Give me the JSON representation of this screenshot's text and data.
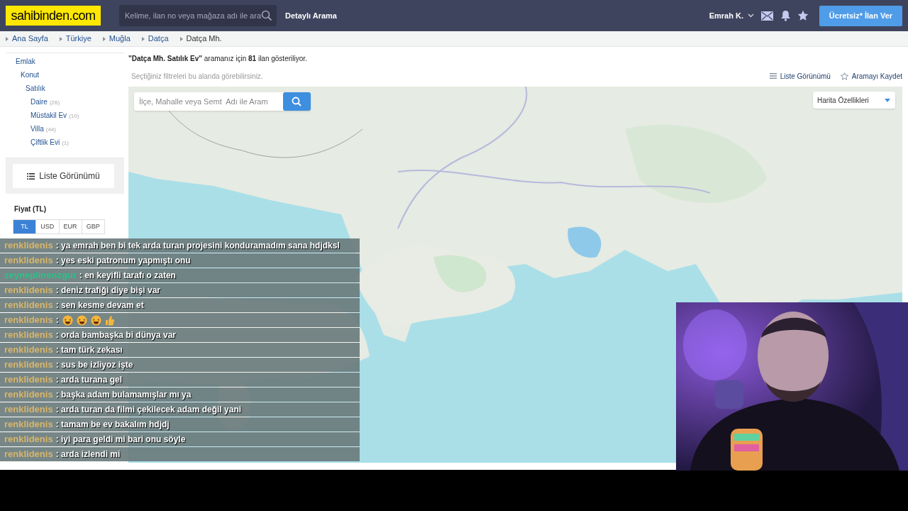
{
  "header": {
    "logo": "sahibinden.com",
    "search_placeholder": "Kelime, ilan no veya mağaza adı ile ara",
    "advanced_search": "Detaylı Arama",
    "user": "Emrah K.",
    "post_button": "Ücretsiz* İlan Ver"
  },
  "breadcrumbs": [
    {
      "label": "Ana Sayfa",
      "current": false
    },
    {
      "label": "Türkiye",
      "current": false
    },
    {
      "label": "Muğla",
      "current": false
    },
    {
      "label": "Datça",
      "current": false
    },
    {
      "label": "Datça Mh.",
      "current": true
    }
  ],
  "categories": [
    {
      "label": "Emlak",
      "children": [
        {
          "label": "Konut",
          "children": [
            {
              "label": "Satılık",
              "children": [
                {
                  "label": "Daire",
                  "count": "(26)"
                },
                {
                  "label": "Müstakil Ev",
                  "count": "(10)"
                },
                {
                  "label": "Villa",
                  "count": "(44)"
                },
                {
                  "label": "Çiftlik Evi",
                  "count": "(1)"
                }
              ]
            }
          ]
        }
      ]
    }
  ],
  "list_view_button": "Liste Görünümü",
  "price_filter": {
    "title": "Fiyat (TL)",
    "currencies": [
      {
        "label": "TL",
        "selected": true
      },
      {
        "label": "USD",
        "selected": false
      },
      {
        "label": "EUR",
        "selected": false
      },
      {
        "label": "GBP",
        "selected": false
      }
    ]
  },
  "results": {
    "summary": "**\"Datça Mh. Satılık Ev\"** aramanız için **81** ilan gösteriliyor.",
    "filters_hint": "Seçtiğiniz filtreleri bu alanda görebilirsiniz.",
    "list_view_link": "Liste Görünümü",
    "save_search_link": "Aramayı Kaydet"
  },
  "map": {
    "kind": "picture",
    "search_placeholder": "İlçe, Mahalle veya Semt  Adı ile Aram",
    "features_dropdown": "Harita Özellikleri"
  },
  "chat": [
    {
      "user": "renklidenis",
      "color": "#d9b66a",
      "text": ": ya emrah ben bi tek arda turan projesini konduramadım sana hdjdksl",
      "kind": "text"
    },
    {
      "user": "renklidenis",
      "color": "#d9b66a",
      "text": ": yes eski patronum yapmıştı onu",
      "kind": "text"
    },
    {
      "user": "zeyneplineozgur",
      "color": "#2fbf8a",
      "text": ": en keyifli tarafı o zaten",
      "kind": "text"
    },
    {
      "user": "renklidenis",
      "color": "#d9b66a",
      "text": ": deniz trafiği diye bişi var",
      "kind": "text"
    },
    {
      "user": "renklidenis",
      "color": "#d9b66a",
      "text": ": sen kesme devam et",
      "kind": "text"
    },
    {
      "user": "renklidenis",
      "color": "#d9b66a",
      "text": ":",
      "kind": "emotes"
    },
    {
      "user": "renklidenis",
      "color": "#d9b66a",
      "text": ": orda bambaşka bi dünya var",
      "kind": "text"
    },
    {
      "user": "renklidenis",
      "color": "#d9b66a",
      "text": ": tam türk zekası",
      "kind": "text"
    },
    {
      "user": "renklidenis",
      "color": "#d9b66a",
      "text": ": sus be izliyoz işte",
      "kind": "text"
    },
    {
      "user": "renklidenis",
      "color": "#d9b66a",
      "text": ": arda turana gel",
      "kind": "text"
    },
    {
      "user": "renklidenis",
      "color": "#d9b66a",
      "text": ": başka adam bulamamışlar mı ya",
      "kind": "text"
    },
    {
      "user": "renklidenis",
      "color": "#d9b66a",
      "text": ": arda turan da filmi çekilecek adam değil yani",
      "kind": "text"
    },
    {
      "user": "renklidenis",
      "color": "#d9b66a",
      "text": ": tamam be ev bakalım hdjdj",
      "kind": "text"
    },
    {
      "user": "renklidenis",
      "color": "#d9b66a",
      "text": ": iyi para geldi mi bari onu söyle",
      "kind": "text"
    },
    {
      "user": "renklidenis",
      "color": "#d9b66a",
      "text": ": arda izlendi mi",
      "kind": "text"
    }
  ]
}
